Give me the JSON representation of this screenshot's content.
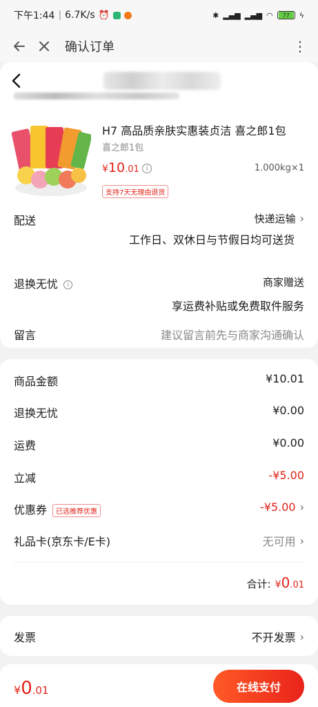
{
  "status_bar": {
    "time": "下午1:44",
    "speed": "6.7K/s",
    "battery": "77"
  },
  "title_bar": {
    "title": "确认订单"
  },
  "product": {
    "name": "H7 高品质亲肤实惠装贞洁 喜之郎1包",
    "spec": "喜之郎1包",
    "price_yen": "¥",
    "price_int": "10",
    "price_dec": ".01",
    "quantity": "1.000kg×1",
    "return_tag": "支持7天无理由退货"
  },
  "delivery": {
    "label": "配送",
    "value": "快递运输",
    "note": "工作日、双休日与节假日均可送货"
  },
  "return_service": {
    "label": "退换无忧",
    "value": "商家赠送",
    "note": "享运费补贴或免费取件服务"
  },
  "message": {
    "label": "留言",
    "placeholder": "建议留言前先与商家沟通确认"
  },
  "summary": {
    "goods_amount_label": "商品金额",
    "goods_amount": "¥10.01",
    "return_label": "退换无忧",
    "return_amount": "¥0.00",
    "shipping_label": "运费",
    "shipping_amount": "¥0.00",
    "discount_label": "立减",
    "discount_amount": "-¥5.00",
    "coupon_label": "优惠券",
    "coupon_tag": "已选推荐优惠",
    "coupon_amount": "-¥5.00",
    "giftcard_label": "礼品卡(京东卡/E卡)",
    "giftcard_value": "无可用",
    "total_label": "合计:",
    "total_yen": "¥",
    "total_int": "0",
    "total_dec": ".01"
  },
  "invoice": {
    "label": "发票",
    "value": "不开发票"
  },
  "bottom": {
    "total_yen": "¥",
    "total_int": "0",
    "total_dec": ".01",
    "pay_label": "在线支付"
  },
  "colors": {
    "accent_red": "#e2231a",
    "pay_gradient_start": "#ff5a26"
  }
}
